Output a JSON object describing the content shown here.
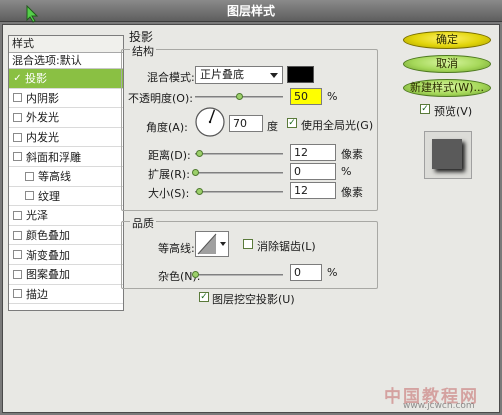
{
  "window": {
    "title": "图层样式"
  },
  "sidebar": {
    "header": "样式",
    "blend_options": "混合选项:默认",
    "items": [
      {
        "label": "投影",
        "checked": true,
        "selected": true
      },
      {
        "label": "内阴影",
        "checked": false
      },
      {
        "label": "外发光",
        "checked": false
      },
      {
        "label": "内发光",
        "checked": false
      },
      {
        "label": "斜面和浮雕",
        "checked": false
      },
      {
        "label": "等高线",
        "checked": false,
        "sub": true
      },
      {
        "label": "纹理",
        "checked": false,
        "sub": true
      },
      {
        "label": "光泽",
        "checked": false
      },
      {
        "label": "颜色叠加",
        "checked": false
      },
      {
        "label": "渐变叠加",
        "checked": false
      },
      {
        "label": "图案叠加",
        "checked": false
      },
      {
        "label": "描边",
        "checked": false
      }
    ]
  },
  "panel": {
    "title": "投影",
    "structure": {
      "title": "结构",
      "blend_mode": {
        "label": "混合模式:",
        "value": "正片叠底",
        "swatch_color": "#000000"
      },
      "opacity": {
        "label": "不透明度(O):",
        "value": "50",
        "unit": "%",
        "fraction": 0.5
      },
      "angle": {
        "label": "角度(A):",
        "value": "70",
        "unit": "度",
        "degrees": 70,
        "global_light": {
          "label": "使用全局光(G)",
          "checked": true
        }
      },
      "distance": {
        "label": "距离(D):",
        "value": "12",
        "unit": "像素",
        "fraction": 0.04
      },
      "spread": {
        "label": "扩展(R):",
        "value": "0",
        "unit": "%",
        "fraction": 0.0
      },
      "size": {
        "label": "大小(S):",
        "value": "12",
        "unit": "像素",
        "fraction": 0.05
      }
    },
    "quality": {
      "title": "品质",
      "contour": {
        "label": "等高线:",
        "anti_alias": {
          "label": "消除锯齿(L)",
          "checked": false
        }
      },
      "noise": {
        "label": "杂色(N):",
        "value": "0",
        "unit": "%",
        "fraction": 0.0
      }
    },
    "knockout": {
      "label": "图层挖空投影(U)",
      "checked": true
    }
  },
  "buttons": {
    "ok": "确定",
    "cancel": "取消",
    "new_style": "新建样式(W)...",
    "preview": {
      "label": "预览(V)",
      "checked": true
    }
  },
  "watermark": {
    "text": "中国教程网",
    "url": "www.jcwcn.com"
  },
  "colors": {
    "accent": "#8ac043",
    "highlight": "#ffff00",
    "ok_button": "#e1d40a",
    "secondary_button": "#a6d85a"
  }
}
